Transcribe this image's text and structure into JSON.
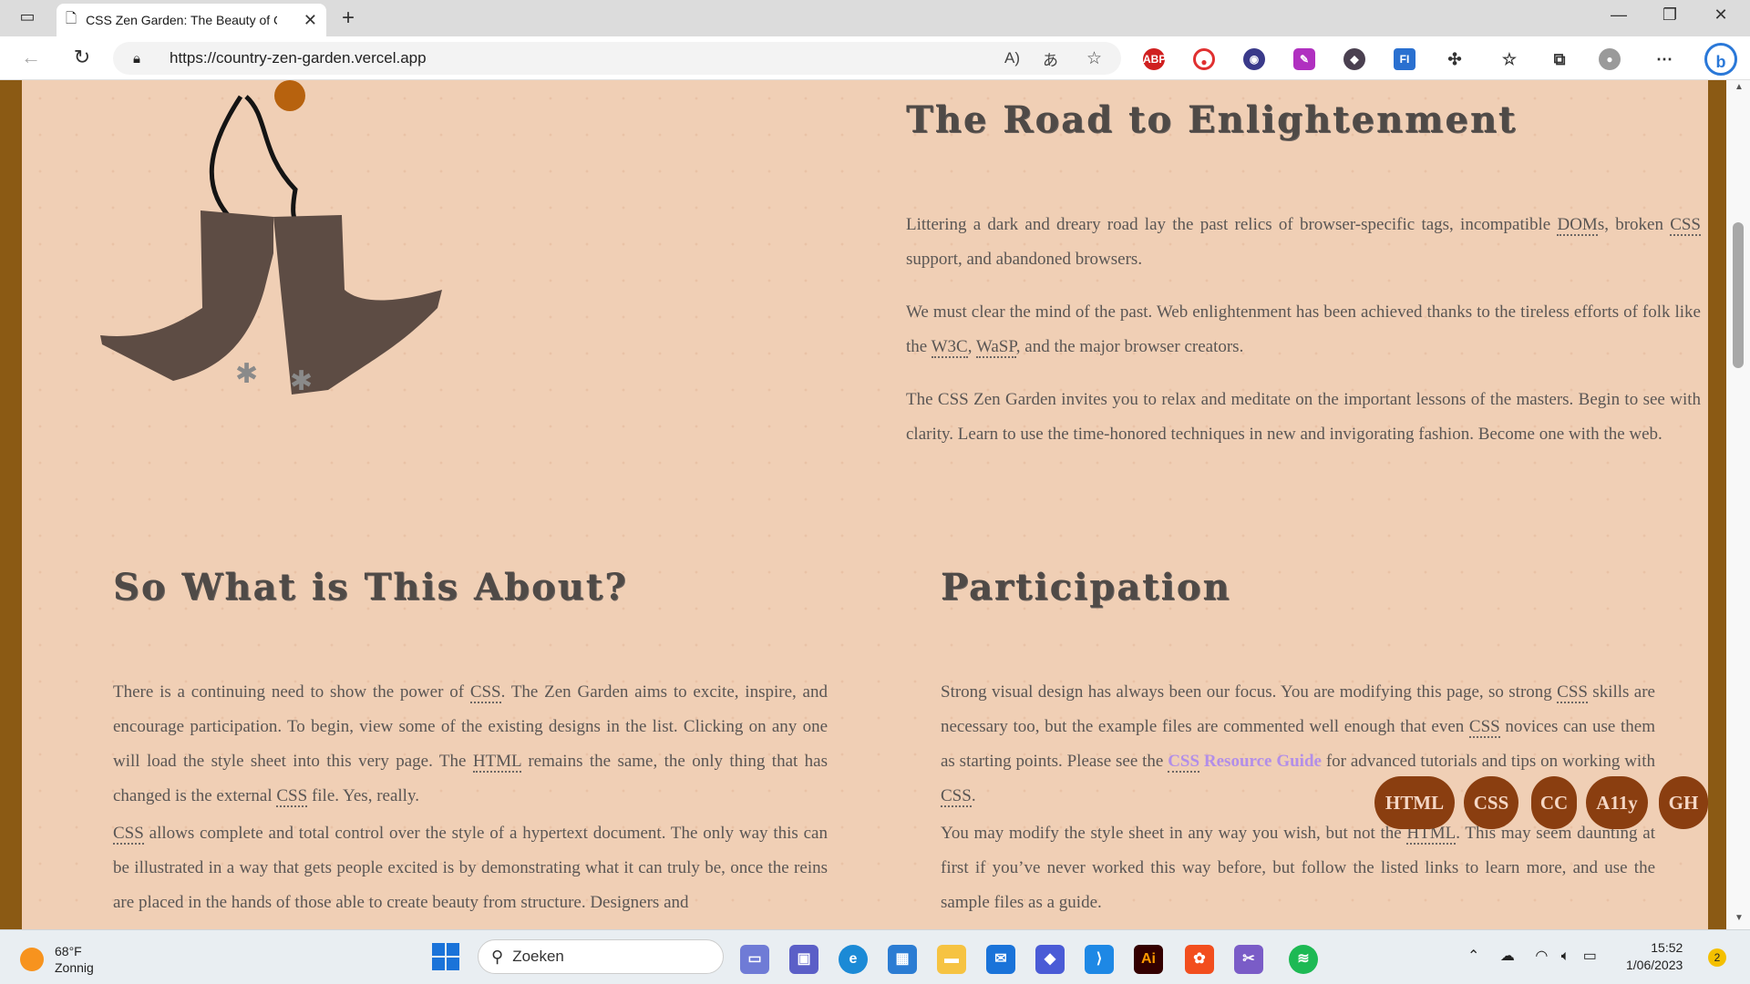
{
  "browser": {
    "tab_title": "CSS Zen Garden: The Beauty of C",
    "url": "https://country-zen-garden.vercel.app"
  },
  "page": {
    "enlightenment": {
      "heading": "The Road to Enlightenment",
      "p1_a": "Littering a dark and dreary road lay the past relics of browser-specific tags, incompatible ",
      "p1_abbr1": "DOM",
      "p1_b": "s, broken ",
      "p1_abbr2": "CSS",
      "p1_c": " support, and abandoned browsers.",
      "p2_a": "We must clear the mind of the past. Web enlightenment has been achieved thanks to the tireless efforts of folk like the ",
      "p2_abbr1": "W3C",
      "p2_b": ", ",
      "p2_abbr2": "WaSP",
      "p2_c": ", and the major browser creators.",
      "p3": "The CSS Zen Garden invites you to relax and meditate on the important lessons of the masters. Begin to see with clarity. Learn to use the time-honored techniques in new and invigorating fashion. Become one with the web."
    },
    "about": {
      "heading": "So What is This About?",
      "p1_a": "There is a continuing need to show the power of ",
      "p1_abbr1": "CSS",
      "p1_b": ". The Zen Garden aims to excite, inspire, and encourage participation. To begin, view some of the existing designs in the list. Clicking on any one will load the style sheet into this very page. The ",
      "p1_abbr2": "HTML",
      "p1_c": " remains the same, the only thing that has changed is the external ",
      "p1_abbr3": "CSS",
      "p1_d": " file. Yes, really.",
      "p2_abbr1": "CSS",
      "p2_a": " allows complete and total control over the style of a hypertext document. The only way this can be illustrated in a way that gets people excited is by demonstrating what it can truly be, once the reins are placed in the hands of those able to create beauty from structure. Designers and"
    },
    "participation": {
      "heading": "Participation",
      "p1_a": "Strong visual design has always been our focus. You are modifying this page, so strong ",
      "p1_abbr1": "CSS",
      "p1_b": " skills are necessary too, but the example files are commented well enough that even ",
      "p1_abbr2": "CSS",
      "p1_c": " novices can use them as starting points. Please see the ",
      "p1_link_abbr": "CSS",
      "p1_link_rest": " Resource Guide",
      "p1_d": " for advanced tutorials and tips on working with ",
      "p1_abbr3": "CSS",
      "p1_e": ".",
      "p2_a": "You may modify the style sheet in any way you wish, but not the ",
      "p2_abbr1": "HTML",
      "p2_b": ". This may seem daunting at first if you’ve never worked this way before, but follow the listed links to learn more, and use the sample files as a guide."
    },
    "badges": [
      "HTML",
      "CSS",
      "CC",
      "A11y",
      "GH"
    ]
  },
  "taskbar": {
    "weather_temp": "68°F",
    "weather_desc": "Zonnig",
    "search_placeholder": "Zoeken",
    "time": "15:52",
    "date": "1/06/2023",
    "notification_count": "2"
  }
}
